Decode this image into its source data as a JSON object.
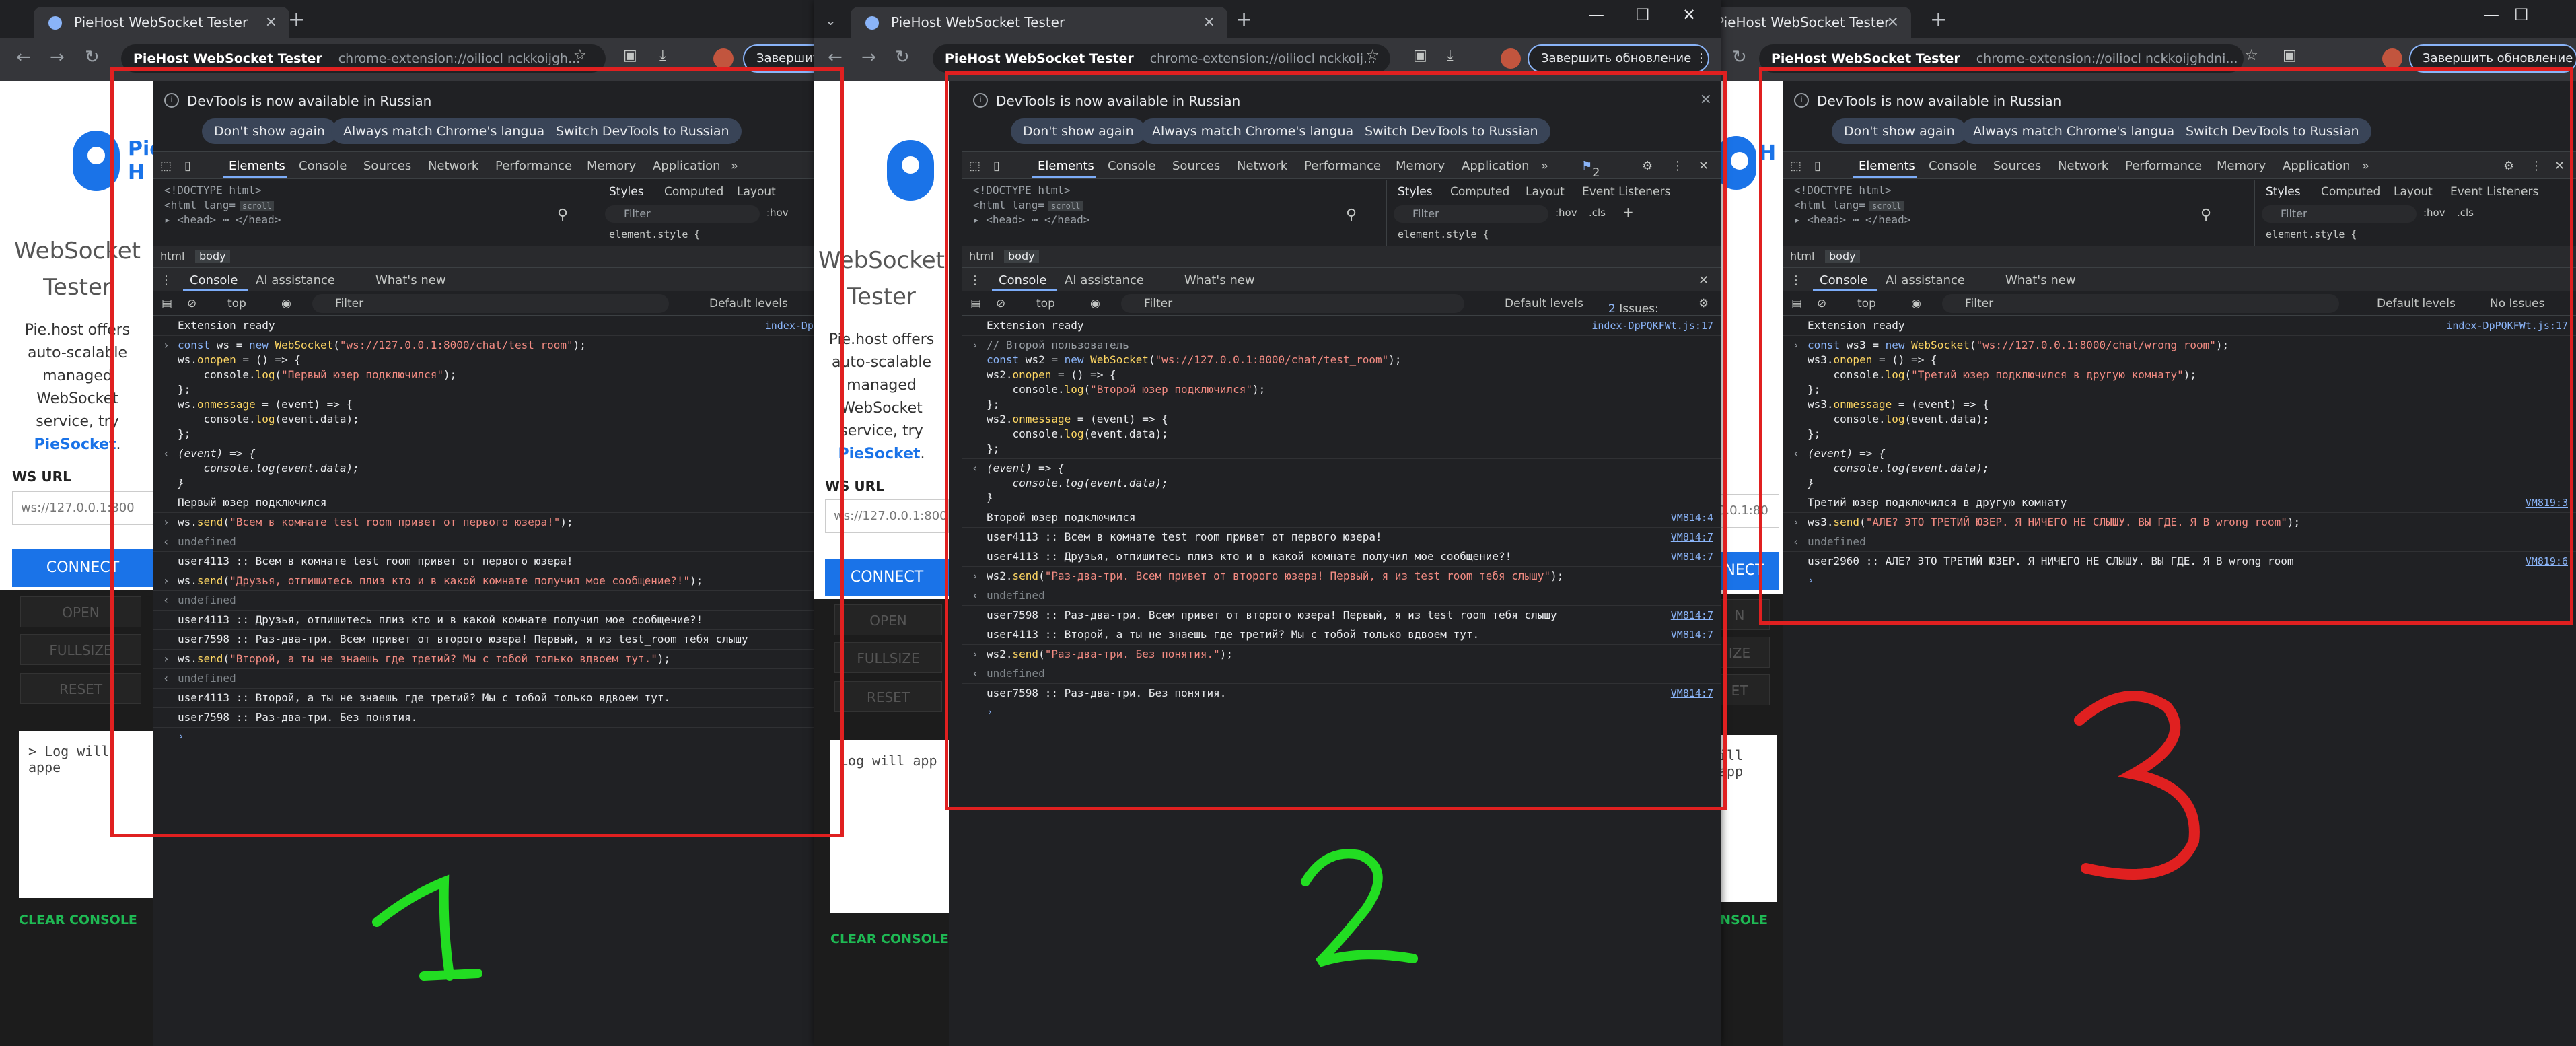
{
  "windows": [
    {
      "tab_title": "PieHost WebSocket Tester",
      "omni_host": "PieHost WebSocket Tester",
      "omni_url": "chrome-extension://oiliocl nckkoijgh...",
      "update_label": "Завершить",
      "page": {
        "title": "WebSocket Tester",
        "desc_1": "Pie.host offers auto-scalable managed WebSocket service, try",
        "link": "PieSocket",
        "url_label": "WS URL",
        "url_value": "ws://127.0.0.1:800",
        "connect": "CONNECT",
        "open": "OPEN",
        "fullsize": "FULLSIZE",
        "reset": "RESET",
        "log": "> Log will appe",
        "clear": "CLEAR CONSOLE"
      }
    },
    {
      "tab_title": "PieHost WebSocket Tester",
      "omni_host": "PieHost WebSocket Tester",
      "omni_url": "chrome-extension://oiliocl nckkoij...",
      "update_label": "Завершить обновление",
      "page": {
        "title": "WebSocket Tester",
        "desc_1": "Pie.host offers auto-scalable managed WebSocket service, try",
        "link": "PieSocket",
        "url_label": "WS URL",
        "url_value": "ws://127.0.0.1:800",
        "connect": "CONNECT",
        "open": "OPEN",
        "fullsize": "FULLSIZE",
        "reset": "RESET",
        "log": "Log will app",
        "clear": "CLEAR CONSOLE"
      }
    },
    {
      "tab_title": "PieHost WebSocket Tester",
      "omni_host": "PieHost WebSocket Tester",
      "omni_url": "chrome-extension://oiliocl nckkoijghdni...",
      "update_label": "Завершить обновление",
      "page": {
        "url_value": "0.0.1:80",
        "connect": "NECT",
        "open": "N",
        "fullsize": "IZE",
        "reset": "ET",
        "log": "ill app",
        "clear": "ONSOLE"
      }
    }
  ],
  "devtools": {
    "notice": "DevTools is now available in Russian",
    "btn_dont_show": "Don't show again",
    "btn_match": "Always match Chrome's language",
    "btn_switch": "Switch DevTools to Russian",
    "tabs": [
      "Elements",
      "Console",
      "Sources",
      "Network",
      "Performance",
      "Memory",
      "Application"
    ],
    "more_tabs": "»",
    "issues_badge": "2",
    "doctype": "<!DOCTYPE html>",
    "html_open": "<html lang=",
    "scroll_badge": "scroll",
    "head_line": "▸ <head> ⋯ </head>",
    "styles_tabs": [
      "Styles",
      "Computed",
      "Layout",
      "Event Listeners"
    ],
    "filter": "Filter",
    "hov": ":hov",
    "cls": ".cls",
    "element_style": "element.style {",
    "crumb_html": "html",
    "crumb_body": "body",
    "drawer_console": "Console",
    "drawer_ai": "AI assistance",
    "drawer_new": "What's new",
    "top": "top",
    "levels": "Default levels",
    "issues_2": "2 Issues:",
    "issues_2_count": "2",
    "no_issues": "No Issues",
    "extension_ready": "Extension ready",
    "src_index": "index-DpPQKFWt.js:17",
    "src_index_short": "index-DpP"
  },
  "console1": {
    "code": [
      "const ws = new WebSocket(\"ws://127.0.0.1:8000/chat/test_room\");",
      "ws.onopen = () => {",
      "    console.log(\"Первый юзер подключился\");",
      "};",
      "ws.onmessage = (event) => {",
      "    console.log(event.data);",
      "};"
    ],
    "ret": [
      "(event) => {",
      "    console.log(event.data);",
      "}"
    ],
    "lines": [
      {
        "t": "out",
        "text": "Первый юзер подключился"
      },
      {
        "t": "in",
        "text": "ws.send(\"Всем в комнате test_room привет от первого юзера!\");"
      },
      {
        "t": "undef",
        "text": "undefined"
      },
      {
        "t": "out",
        "text": "user4113 :: Всем в комнате test_room привет от первого юзера!"
      },
      {
        "t": "in",
        "text": "ws.send(\"Друзья, отпишитесь плиз кто и в какой комнате получил мое сообщение?!\");"
      },
      {
        "t": "undef",
        "text": "undefined"
      },
      {
        "t": "out",
        "text": "user4113 :: Друзья, отпишитесь плиз кто и в какой комнате получил мое сообщение?!"
      },
      {
        "t": "out",
        "text": "user7598 :: Раз-два-три. Всем привет от второго юзера! Первый, я из test_room тебя слышу"
      },
      {
        "t": "in",
        "text": "ws.send(\"Второй, а ты не знаешь где третий? Мы с тобой только вдвоем тут.\");"
      },
      {
        "t": "undef",
        "text": "undefined"
      },
      {
        "t": "out",
        "text": "user4113 :: Второй, а ты не знаешь где третий? Мы с тобой только вдвоем тут."
      },
      {
        "t": "out",
        "text": "user7598 :: Раз-два-три. Без понятия."
      }
    ]
  },
  "console2": {
    "comment": "// Второй пользователь",
    "code": [
      "const ws2 = new WebSocket(\"ws://127.0.0.1:8000/chat/test_room\");",
      "ws2.onopen = () => {",
      "    console.log(\"Второй юзер подключился\");",
      "};",
      "ws2.onmessage = (event) => {",
      "    console.log(event.data);",
      "};"
    ],
    "ret": [
      "(event) => {",
      "    console.log(event.data);",
      "}"
    ],
    "lines": [
      {
        "t": "out",
        "text": "Второй юзер подключился",
        "src": "VM814:4"
      },
      {
        "t": "out",
        "text": "user4113 :: Всем в комнате test_room привет от первого юзера!",
        "src": "VM814:7"
      },
      {
        "t": "out",
        "text": "user4113 :: Друзья, отпишитесь плиз кто и в какой комнате получил мое сообщение?!",
        "src": "VM814:7"
      },
      {
        "t": "in",
        "text": "ws2.send(\"Раз-два-три. Всем привет от второго юзера! Первый, я из test_room тебя слышу\");"
      },
      {
        "t": "undef",
        "text": "undefined"
      },
      {
        "t": "out",
        "text": "user7598 :: Раз-два-три. Всем привет от второго юзера! Первый, я из test_room тебя слышу",
        "src": "VM814:7"
      },
      {
        "t": "out",
        "text": "user4113 :: Второй, а ты не знаешь где третий? Мы с тобой только вдвоем тут.",
        "src": "VM814:7"
      },
      {
        "t": "in",
        "text": "ws2.send(\"Раз-два-три. Без понятия.\");"
      },
      {
        "t": "undef",
        "text": "undefined"
      },
      {
        "t": "out",
        "text": "user7598 :: Раз-два-три. Без понятия.",
        "src": "VM814:7"
      }
    ]
  },
  "console3": {
    "code": [
      "const ws3 = new WebSocket(\"ws://127.0.0.1:8000/chat/wrong_room\");",
      "ws3.onopen = () => {",
      "    console.log(\"Третий юзер подключился в другую комнату\");",
      "};",
      "ws3.onmessage = (event) => {",
      "    console.log(event.data);",
      "};"
    ],
    "ret": [
      "(event) => {",
      "    console.log(event.data);",
      "}"
    ],
    "lines": [
      {
        "t": "out",
        "text": "Третий юзер подключился в другую комнату",
        "src": "VM819:3"
      },
      {
        "t": "in",
        "text": "ws3.send(\"АЛЕ? ЭТО ТРЕТИЙ ЮЗЕР. Я НИЧЕГО НЕ СЛЫШУ. ВЫ ГДЕ. Я В wrong_room\");"
      },
      {
        "t": "undef",
        "text": "undefined"
      },
      {
        "t": "out",
        "text": "user2960 :: АЛЕ? ЭТО ТРЕТИЙ ЮЗЕР. Я НИЧЕГО НЕ СЛЫШУ. ВЫ ГДЕ. Я В wrong_room",
        "src": "VM819:6"
      }
    ]
  },
  "annotations": {
    "n1": "1",
    "n2": "2",
    "n3": "3"
  },
  "colors": {
    "annotation_rect": "#e02020",
    "annotation_green": "#22dd22",
    "annotation_red": "#e02020",
    "accent": "#1a73e8"
  }
}
